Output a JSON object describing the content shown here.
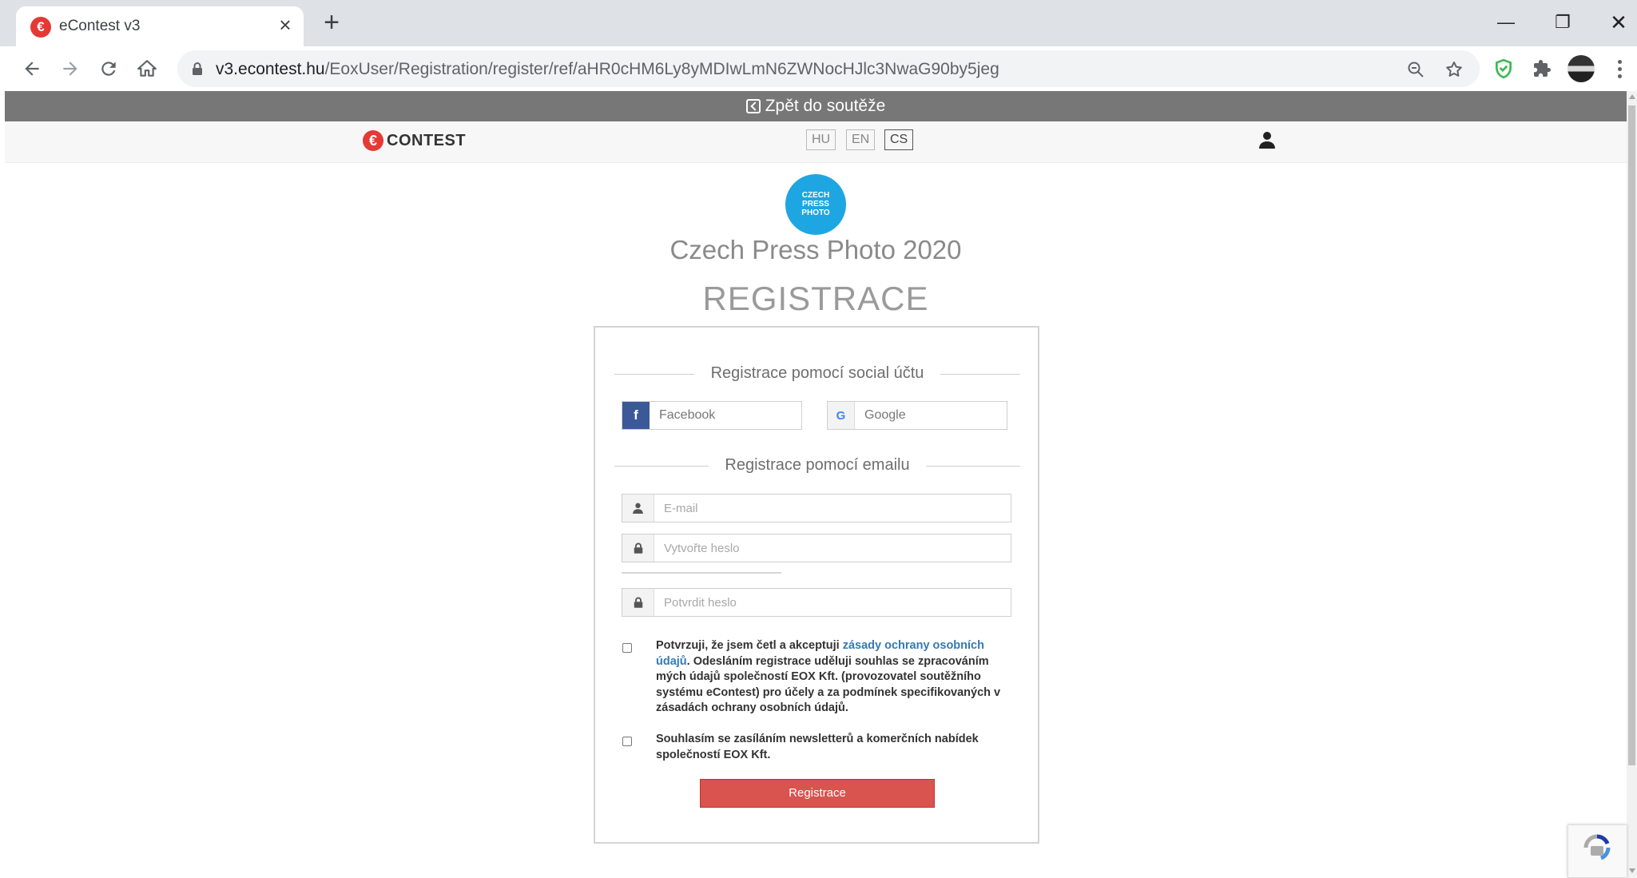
{
  "browser": {
    "tab_title": "eContest v3",
    "tab_close": "×",
    "new_tab": "+",
    "url_host": "v3.econtest.hu",
    "url_path": "/EoxUser/Registration/register/ref/aHR0cHM6Ly8yMDIwLmN6ZWNocHJlc3NwaG90by5jeg",
    "window_controls": {
      "minimize": "—",
      "maximize": "❐",
      "close": "✕"
    }
  },
  "page": {
    "back_link": "Zpět do soutěže",
    "logo_letter": "€",
    "logo_text": "CONTEST",
    "languages": [
      {
        "code": "HU",
        "active": false
      },
      {
        "code": "EN",
        "active": false
      },
      {
        "code": "CS",
        "active": true
      }
    ],
    "badge_lines": [
      "CZECH",
      "PRESS",
      "PHOTO"
    ],
    "contest_title": "Czech Press Photo 2020",
    "heading": "REGISTRACE",
    "social": {
      "title": "Registrace pomocí social účtu",
      "facebook_label": "Facebook",
      "facebook_icon": "f",
      "google_label": "Google",
      "google_icon": "G"
    },
    "email_section": {
      "title": "Registrace pomocí emailu",
      "email_placeholder": "E-mail",
      "password_placeholder": "Vytvořte heslo",
      "confirm_placeholder": "Potvrdit heslo"
    },
    "consent": {
      "privacy_before": "Potvrzuji, že jsem četl a akceptuji ",
      "privacy_link": "zásady ochrany osobních údajů",
      "privacy_after": ". Odesláním registrace uděluji souhlas se zpracováním mých údajů společností EOX Kft. (provozovatel soutěžního systému eContest) pro účely a za podmínek specifikovaných v zásadách ochrany osobních údajů.",
      "newsletter": "Souhlasím se zasíláním newsletterů a komerčních nabídek společností EOX Kft."
    },
    "submit_label": "Registrace"
  },
  "colors": {
    "back_bar": "#777777",
    "brand_red": "#e53935",
    "badge_blue": "#1ea6e2",
    "facebook_blue": "#3b5998",
    "submit_red": "#d9534f",
    "link_blue": "#337ab7"
  }
}
